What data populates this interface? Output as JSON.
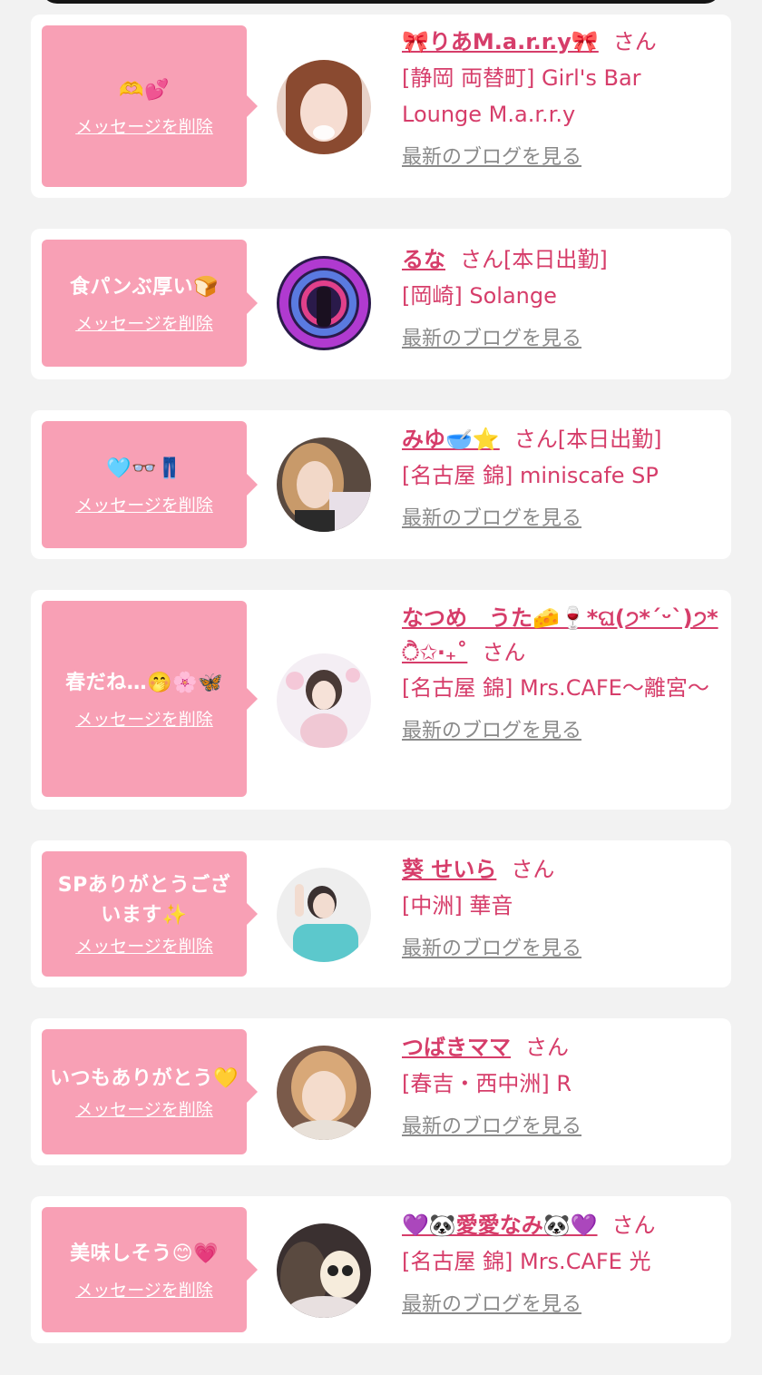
{
  "delete_label": "メッセージを削除",
  "san_label": "さん",
  "blog_label": "最新のブログを見る",
  "colors": {
    "bubble": "#f8a0b5",
    "accent": "#d63d6a",
    "card": "#ffffff",
    "background": "#f2f2f2",
    "link_gray": "#8a8a8a"
  },
  "items": [
    {
      "message": "🫶💕",
      "name": "🎀りあM.a.r.r.y🎀",
      "status": "",
      "shop": "[静岡 両替町] Girl's Bar Lounge M.a.r.r.y",
      "avatar": "woman-portrait"
    },
    {
      "message": "食パンぶ厚い🍞",
      "name": "るな",
      "status": "[本日出勤]",
      "shop": "[岡崎] Solange",
      "avatar": "light-tunnel-photo"
    },
    {
      "message": "🩵👓👖",
      "name": "みゆ🥣⭐️",
      "status": "[本日出勤]",
      "shop": "[名古屋 錦] miniscafe SP",
      "avatar": "woman-portrait"
    },
    {
      "message": "春だね…🤭🌸🦋",
      "name": "なつめ　うた🧀🍷*ଘ(੭*ˊᵕˋ)੭* ੈ✩‧₊˚",
      "status": "",
      "shop": "[名古屋 錦] Mrs.CAFE～離宮～",
      "avatar": "woman-portrait"
    },
    {
      "message": "SPありがとうございます✨",
      "name": "葵 せいら",
      "status": "",
      "shop": "[中洲] 華音",
      "avatar": "woman-portrait"
    },
    {
      "message": "いつもありがとう💛",
      "name": "つばきママ",
      "status": "",
      "shop": "[春吉・西中洲] R",
      "avatar": "woman-portrait"
    },
    {
      "message": "美味しそう😊💗",
      "name": "💜🐼愛愛なみ🐼💜",
      "status": "",
      "shop": "[名古屋 錦] Mrs.CAFE 光",
      "avatar": "panda-sticker-portrait"
    }
  ]
}
